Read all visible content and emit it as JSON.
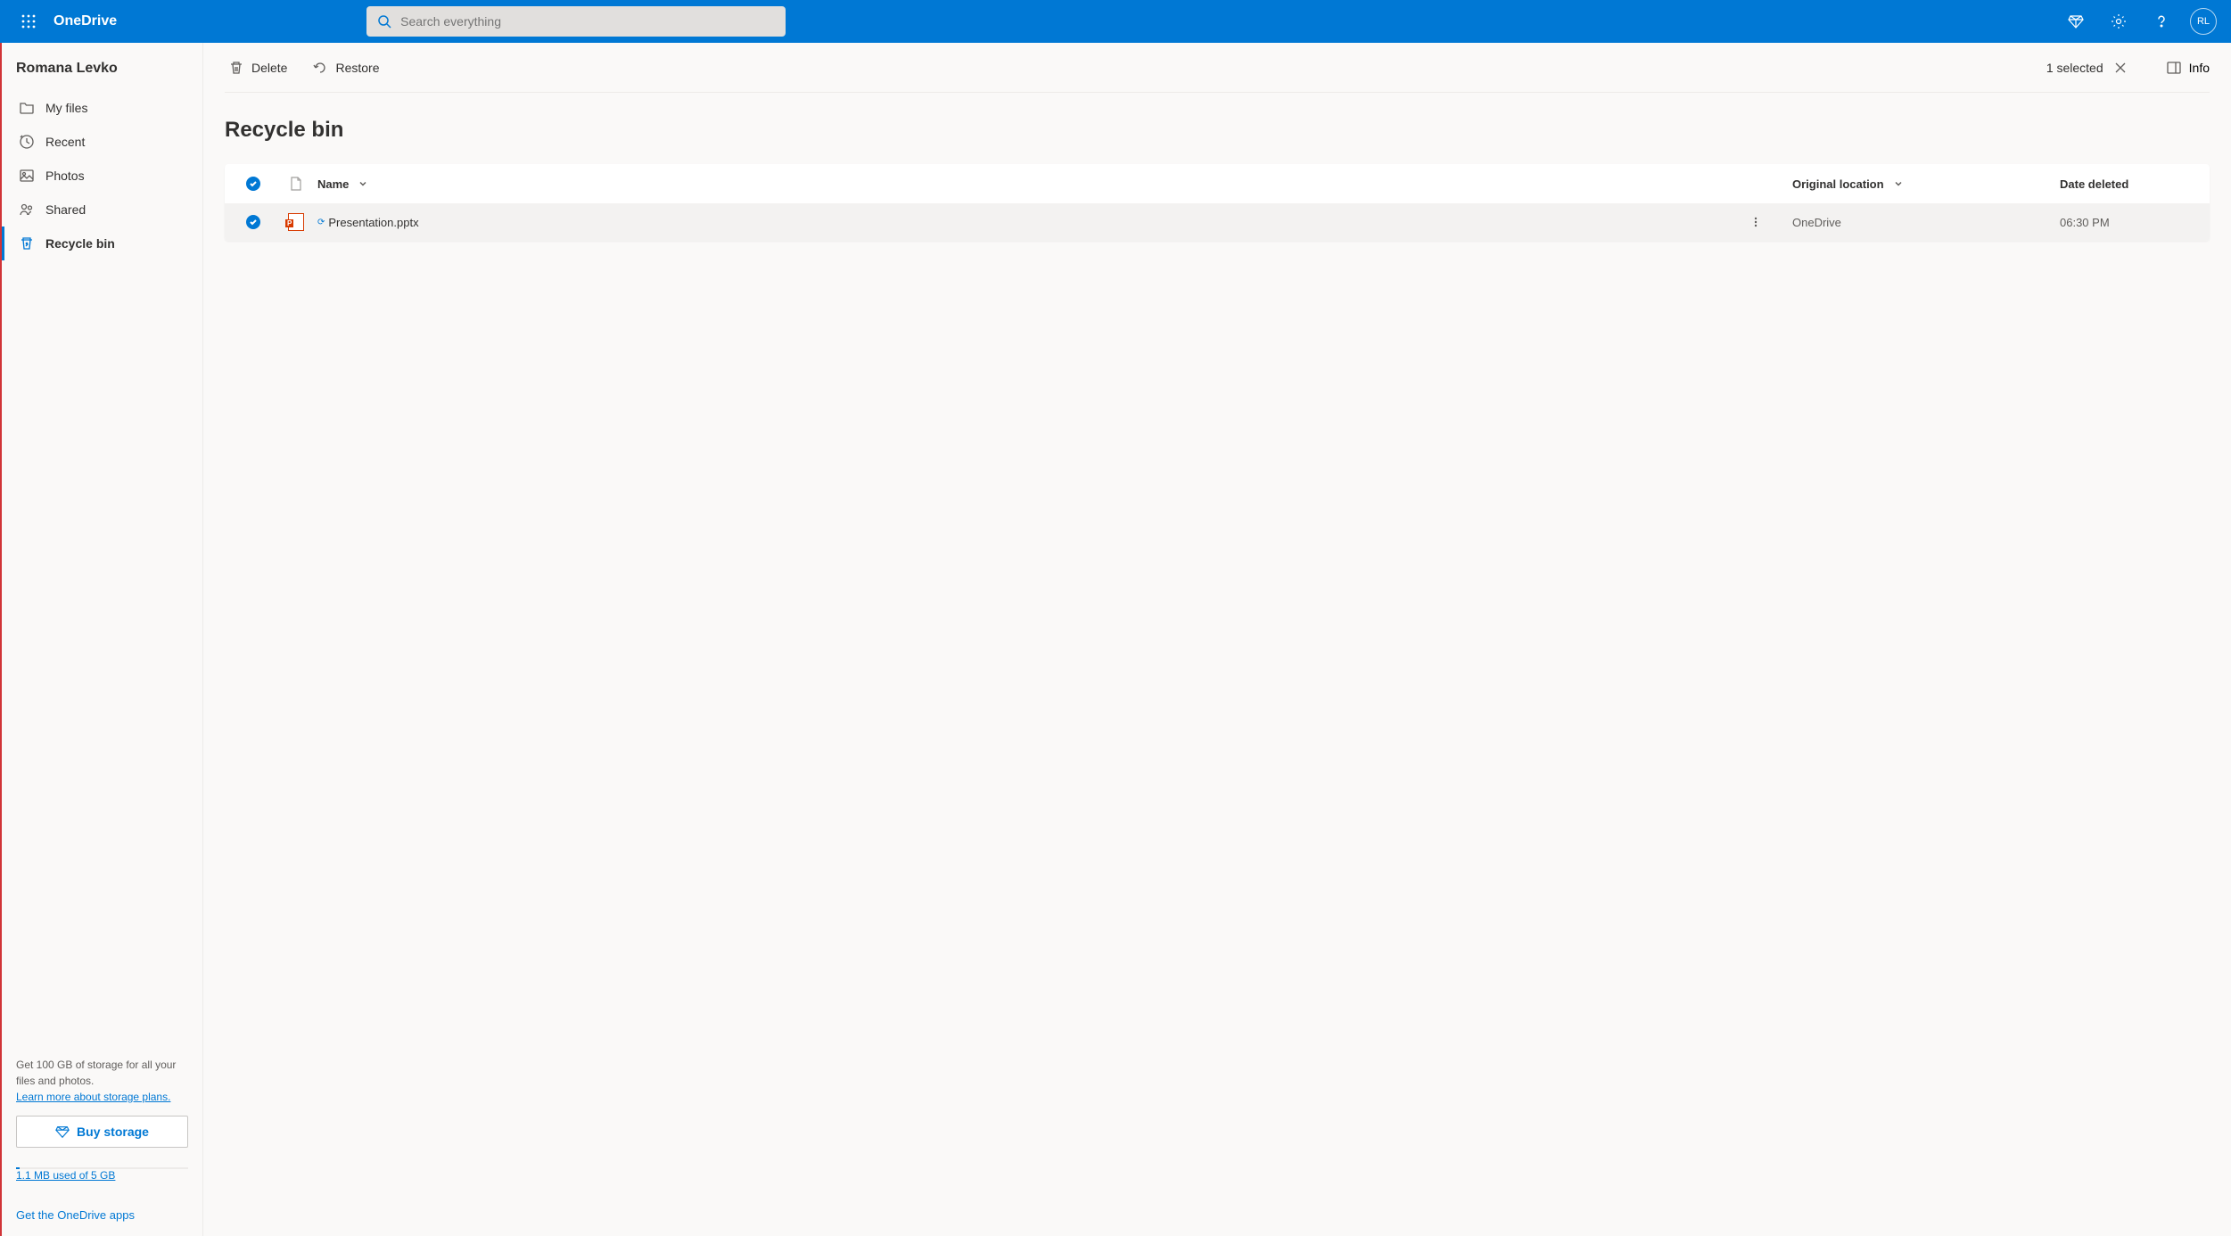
{
  "header": {
    "brand": "OneDrive",
    "search_placeholder": "Search everything",
    "avatar_initials": "RL"
  },
  "sidebar": {
    "user_name": "Romana Levko",
    "nav": [
      {
        "label": "My files",
        "icon": "folder"
      },
      {
        "label": "Recent",
        "icon": "clock"
      },
      {
        "label": "Photos",
        "icon": "photo"
      },
      {
        "label": "Shared",
        "icon": "people"
      },
      {
        "label": "Recycle bin",
        "icon": "recycle",
        "active": true
      }
    ],
    "storage_promo": "Get 100 GB of storage for all your files and photos.",
    "storage_learn": "Learn more about storage plans.",
    "buy_label": "Buy storage",
    "storage_used": "1.1 MB used of 5 GB",
    "get_apps": "Get the OneDrive apps"
  },
  "toolbar": {
    "delete_label": "Delete",
    "restore_label": "Restore",
    "selected_text": "1 selected",
    "info_label": "Info"
  },
  "main": {
    "title": "Recycle bin",
    "columns": {
      "name": "Name",
      "location": "Original location",
      "date": "Date deleted"
    },
    "rows": [
      {
        "name": "Presentation.pptx",
        "location": "OneDrive",
        "date": "06:30 PM"
      }
    ]
  }
}
